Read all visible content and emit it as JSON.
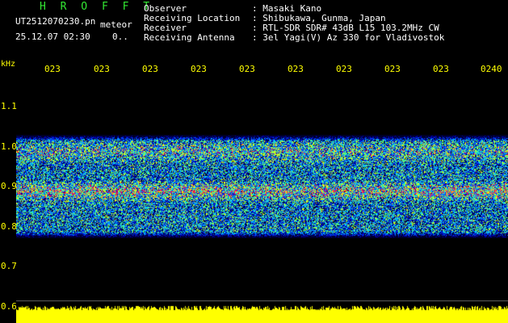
{
  "header": {
    "station": "H R O F F T",
    "filename": "UT2512070230.pn",
    "mode": "meteor",
    "datetime": "25.12.07 02:30",
    "counter": "0..",
    "info": [
      {
        "label": "Observer",
        "value": ": Masaki Kano"
      },
      {
        "label": "Receiving Location",
        "value": ": Shibukawa, Gunma, Japan"
      },
      {
        "label": "Receiver",
        "value": ": RTL-SDR SDR# 43dB L15 103.2MHz CW"
      },
      {
        "label": "Receiving Antenna",
        "value": ": 3el Yagi(V) Az 330 for Vladivostok"
      }
    ]
  },
  "axis": {
    "y_unit": "kHz",
    "y_ticks": [
      "1.1",
      "1.0",
      "0.9",
      "0.8",
      "0.7",
      "0.6"
    ],
    "x_ticks": [
      "023",
      "023",
      "023",
      "023",
      "023",
      "023",
      "023",
      "023",
      "023",
      "0240"
    ]
  },
  "spectrogram": {
    "noise_band_khz": [
      0.78,
      1.03
    ],
    "echo_band_khz": [
      0.875,
      0.91
    ],
    "palette": [
      "#000020",
      "#0000b4",
      "#0050ff",
      "#00c8ff",
      "#64ff64",
      "#ffff00",
      "#ff0050"
    ]
  },
  "colors": {
    "title": "#33e833",
    "ticks": "#ffff00",
    "text": "#ffffff",
    "background": "#000000",
    "baseline": "#ffff00"
  }
}
